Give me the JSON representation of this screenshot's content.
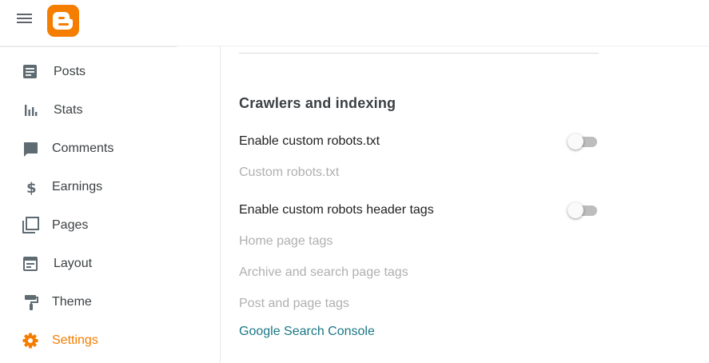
{
  "header": {
    "menu_icon": "hamburger-menu-icon",
    "logo_icon": "blogger-logo-icon",
    "brand_color": "#f57d00"
  },
  "sidebar": {
    "items": [
      {
        "label": "Posts",
        "icon": "posts-icon",
        "active": false
      },
      {
        "label": "Stats",
        "icon": "stats-icon",
        "active": false
      },
      {
        "label": "Comments",
        "icon": "comments-icon",
        "active": false
      },
      {
        "label": "Earnings",
        "icon": "dollar-icon",
        "active": false
      },
      {
        "label": "Pages",
        "icon": "pages-icon",
        "active": false
      },
      {
        "label": "Layout",
        "icon": "layout-icon",
        "active": false
      },
      {
        "label": "Theme",
        "icon": "paint-roller-icon",
        "active": false
      },
      {
        "label": "Settings",
        "icon": "gear-icon",
        "active": true
      }
    ],
    "active_color": "#f57d00"
  },
  "main": {
    "section_title": "Crawlers and indexing",
    "custom_robots": {
      "label": "Enable custom robots.txt",
      "enabled": false,
      "sub_label": "Custom robots.txt"
    },
    "robots_header_tags": {
      "label": "Enable custom robots header tags",
      "enabled": false,
      "sub_items": [
        "Home page tags",
        "Archive and search page tags",
        "Post and page tags"
      ]
    },
    "search_console_link": "Google Search Console",
    "link_color": "#1a7785"
  }
}
